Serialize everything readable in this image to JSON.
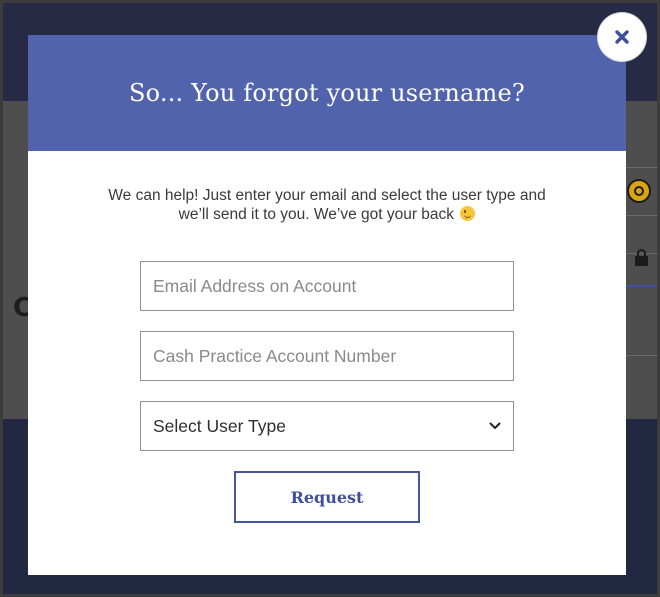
{
  "modal": {
    "title": "So... You forgot your username?",
    "intro_line1": "We can help! Just enter your email and select the user type and",
    "intro_line2": "we’ll send it to you. We’ve got your back",
    "intro_emoji": "winking-face-icon",
    "email_placeholder": "Email Address on Account",
    "email_value": "",
    "account_placeholder": "Cash Practice Account Number",
    "account_value": "",
    "user_type_selected": "Select User Type",
    "request_label": "Request",
    "close_icon": "close-icon"
  },
  "background": {
    "partial_letter": "C",
    "field_icons": [
      "key-badge-icon",
      "lock-icon"
    ]
  },
  "colors": {
    "header": "#5263ae",
    "accent": "#3d4f9e",
    "overlay": "#1f2340"
  }
}
